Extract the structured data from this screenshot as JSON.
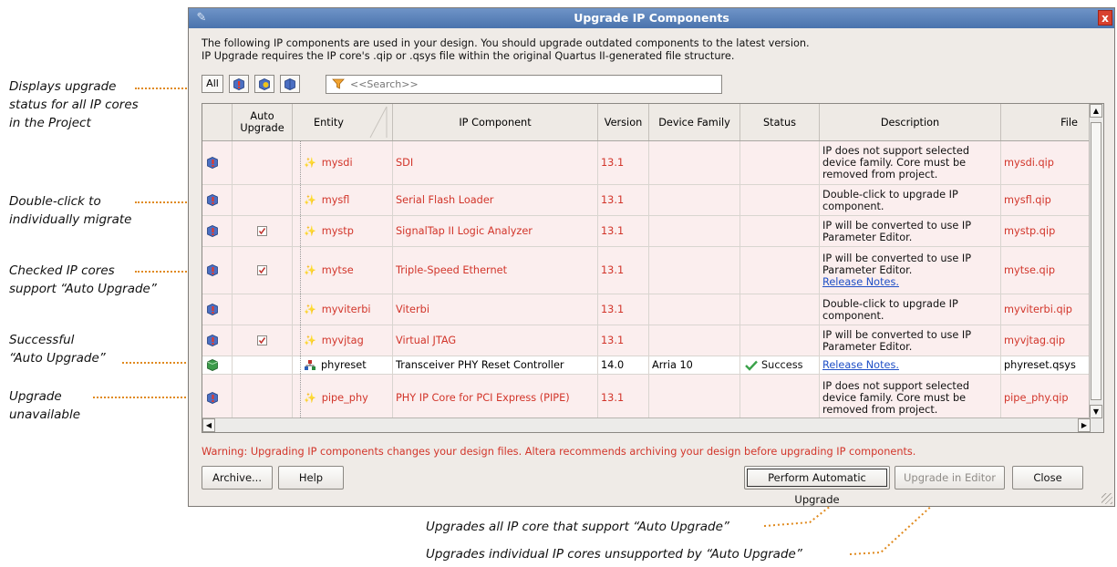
{
  "window": {
    "title": "Upgrade IP Components",
    "close_label": "x"
  },
  "intro": {
    "line1": "The following IP components are used in your design. You should upgrade outdated components to the latest version.",
    "line2": "IP Upgrade requires the IP core's .qip or .qsys file within the original Quartus II-generated file structure."
  },
  "toolbar": {
    "all_label": "All",
    "search_placeholder": "<<Search>>"
  },
  "table": {
    "columns": [
      "",
      "Auto Upgrade",
      "Entity",
      "IP Component",
      "Version",
      "Device Family",
      "Status",
      "Description",
      "File"
    ],
    "rows": [
      {
        "state": "outdated",
        "auto": false,
        "entity": "mysdi",
        "ip": "SDI",
        "version": "13.1",
        "family": "",
        "status": "",
        "desc": [
          "IP does not support selected",
          "device family. Core must be",
          "removed from project."
        ],
        "link": "",
        "file": "mysdi.qip"
      },
      {
        "state": "outdated",
        "auto": false,
        "entity": "mysfl",
        "ip": "Serial Flash Loader",
        "version": "13.1",
        "family": "",
        "status": "",
        "desc": [
          "Double-click to upgrade IP",
          "component."
        ],
        "link": "",
        "file": "mysfl.qip"
      },
      {
        "state": "outdated",
        "auto": true,
        "entity": "mystp",
        "ip": "SignalTap II Logic Analyzer",
        "version": "13.1",
        "family": "",
        "status": "",
        "desc": [
          "IP will be converted to use IP",
          "Parameter Editor."
        ],
        "link": "",
        "file": "mystp.qip"
      },
      {
        "state": "outdated",
        "auto": true,
        "entity": "mytse",
        "ip": "Triple-Speed Ethernet",
        "version": "13.1",
        "family": "",
        "status": "",
        "desc": [
          "IP will be converted to use IP",
          "Parameter Editor."
        ],
        "link": "Release Notes.",
        "file": "mytse.qip"
      },
      {
        "state": "outdated",
        "auto": false,
        "entity": "myviterbi",
        "ip": "Viterbi",
        "version": "13.1",
        "family": "",
        "status": "",
        "desc": [
          "Double-click to upgrade IP",
          "component."
        ],
        "link": "",
        "file": "myviterbi.qip"
      },
      {
        "state": "outdated",
        "auto": true,
        "entity": "myvjtag",
        "ip": "Virtual JTAG",
        "version": "13.1",
        "family": "",
        "status": "",
        "desc": [
          "IP will be converted to use IP",
          "Parameter Editor."
        ],
        "link": "",
        "file": "myvjtag.qip"
      },
      {
        "state": "success",
        "auto": false,
        "entity": "phyreset",
        "ip": "Transceiver PHY Reset Controller",
        "version": "14.0",
        "family": "Arria 10",
        "status": "Success",
        "desc": [],
        "link": "Release Notes.",
        "file": "phyreset.qsys"
      },
      {
        "state": "outdated",
        "auto": false,
        "entity": "pipe_phy",
        "ip": "PHY IP Core for PCI Express (PIPE)",
        "version": "13.1",
        "family": "",
        "status": "",
        "desc": [
          "IP does not support selected",
          "device family. Core must be",
          "removed from project."
        ],
        "link": "",
        "file": "pipe_phy.qip"
      }
    ]
  },
  "warning": "Warning: Upgrading IP components changes your design files. Altera recommends archiving your design before upgrading IP components.",
  "buttons": {
    "archive": "Archive...",
    "help": "Help",
    "auto_upgrade": "Perform Automatic Upgrade",
    "upgrade_editor": "Upgrade in Editor",
    "close": "Close"
  },
  "callouts": {
    "c1": [
      "Displays upgrade",
      "status for all IP cores",
      "in the Project"
    ],
    "c2": [
      "Double-click to",
      "individually migrate"
    ],
    "c3": [
      "Checked IP cores",
      " support “Auto Upgrade”"
    ],
    "c4": [
      "Successful",
      "“Auto Upgrade”"
    ],
    "c5": [
      "Upgrade",
      "unavailable"
    ],
    "c6": "Upgrades all IP core that support “Auto Upgrade”",
    "c7": "Upgrades individual IP cores unsupported by “Auto Upgrade”"
  },
  "colors": {
    "outdated_text": "#d2352a",
    "callout_dots": "#e08a1e",
    "link": "#1f4fc6",
    "titlebar": "#4a73ad"
  }
}
